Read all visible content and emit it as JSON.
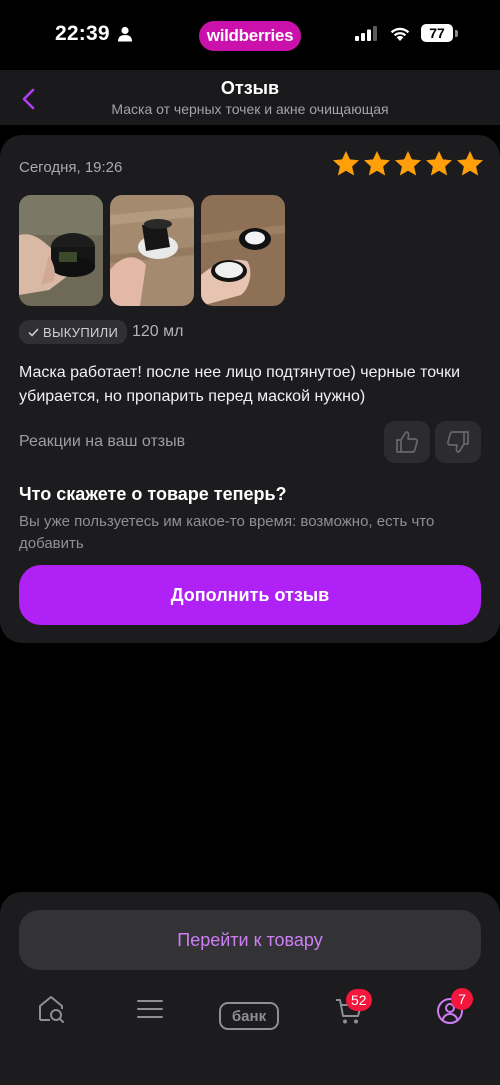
{
  "status_bar": {
    "time": "22:39",
    "brand": "wildberries",
    "battery": "77"
  },
  "header": {
    "title": "Отзыв",
    "subtitle": "Маска от черных точек и акне очищающая"
  },
  "review": {
    "date": "Сегодня, 19:26",
    "rating": 5,
    "badge": "ВЫКУПИЛИ",
    "size": "120 мл",
    "text": "Маска работает! после нее лицо подтянутое) черные точки убирается, но пропарить перед маской нужно)",
    "reactions_label": "Реакции на ваш отзыв"
  },
  "prompt": {
    "question": "Что скажете о товаре теперь?",
    "hint": "Вы уже пользуетесь им какое-то время: возможно, есть что добавить",
    "button": "Дополнить отзыв"
  },
  "goto_button": "Перейти к товару",
  "bottom_nav": {
    "bank_label": "банк",
    "cart_count": "52",
    "profile_count": "7"
  },
  "colors": {
    "accent": "#b021f5",
    "star": "#ff9f0a",
    "badge": "#f4163d",
    "brand": "#cb11ab"
  }
}
